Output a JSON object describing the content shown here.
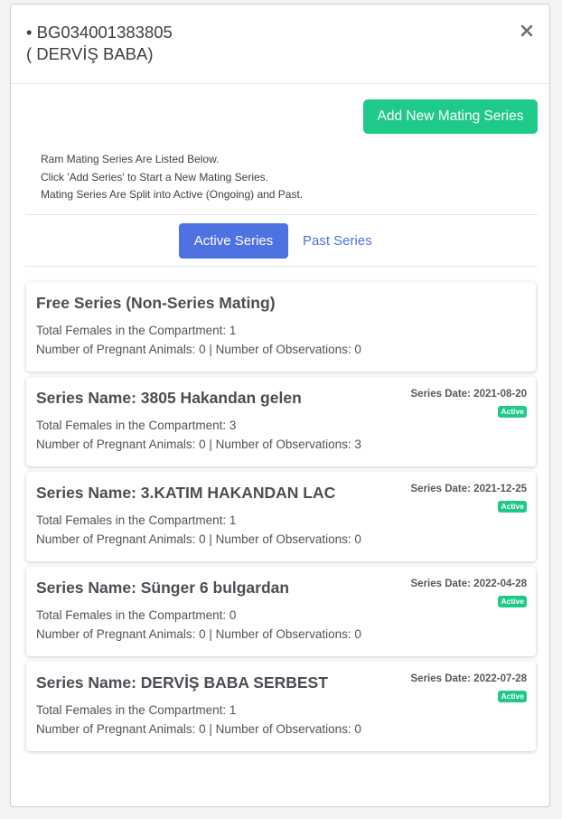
{
  "header": {
    "title_line1": "• BG034001383805",
    "title_line2": "( DERVİŞ BABA)",
    "close_icon": "close-icon"
  },
  "actions": {
    "add_label": "Add New Mating Series"
  },
  "info": {
    "line1": "Ram Mating Series Are Listed Below.",
    "line2": "Click 'Add Series' to Start a New Mating Series.",
    "line3": "Mating Series Are Split into Active (Ongoing) and Past."
  },
  "tabs": {
    "active_label": "Active Series",
    "past_label": "Past Series"
  },
  "colors": {
    "accent_green": "#1fc98a",
    "accent_blue": "#4f72e3"
  },
  "cards": [
    {
      "title": "Free Series (Non-Series Mating)",
      "females": "Total Females in the Compartment: 1",
      "stats": "Number of Pregnant Animals: 0 | Number of Observations: 0"
    },
    {
      "title": "Series Name: 3805 Hakandan gelen",
      "date": "Series Date: 2021-08-20",
      "badge": "Active",
      "females": "Total Females in the Compartment: 3",
      "stats": "Number of Pregnant Animals: 0 | Number of Observations: 3"
    },
    {
      "title": "Series Name: 3.KATIM HAKANDAN LAC",
      "date": "Series Date: 2021-12-25",
      "badge": "Active",
      "females": "Total Females in the Compartment: 1",
      "stats": "Number of Pregnant Animals: 0 | Number of Observations: 0"
    },
    {
      "title": "Series Name: Sünger 6 bulgardan",
      "date": "Series Date: 2022-04-28",
      "badge": "Active",
      "females": "Total Females in the Compartment: 0",
      "stats": "Number of Pregnant Animals: 0 | Number of Observations: 0"
    },
    {
      "title": "Series Name: DERVİŞ BABA SERBEST",
      "date": "Series Date: 2022-07-28",
      "badge": "Active",
      "females": "Total Females in the Compartment: 1",
      "stats": "Number of Pregnant Animals: 0 | Number of Observations: 0"
    }
  ]
}
